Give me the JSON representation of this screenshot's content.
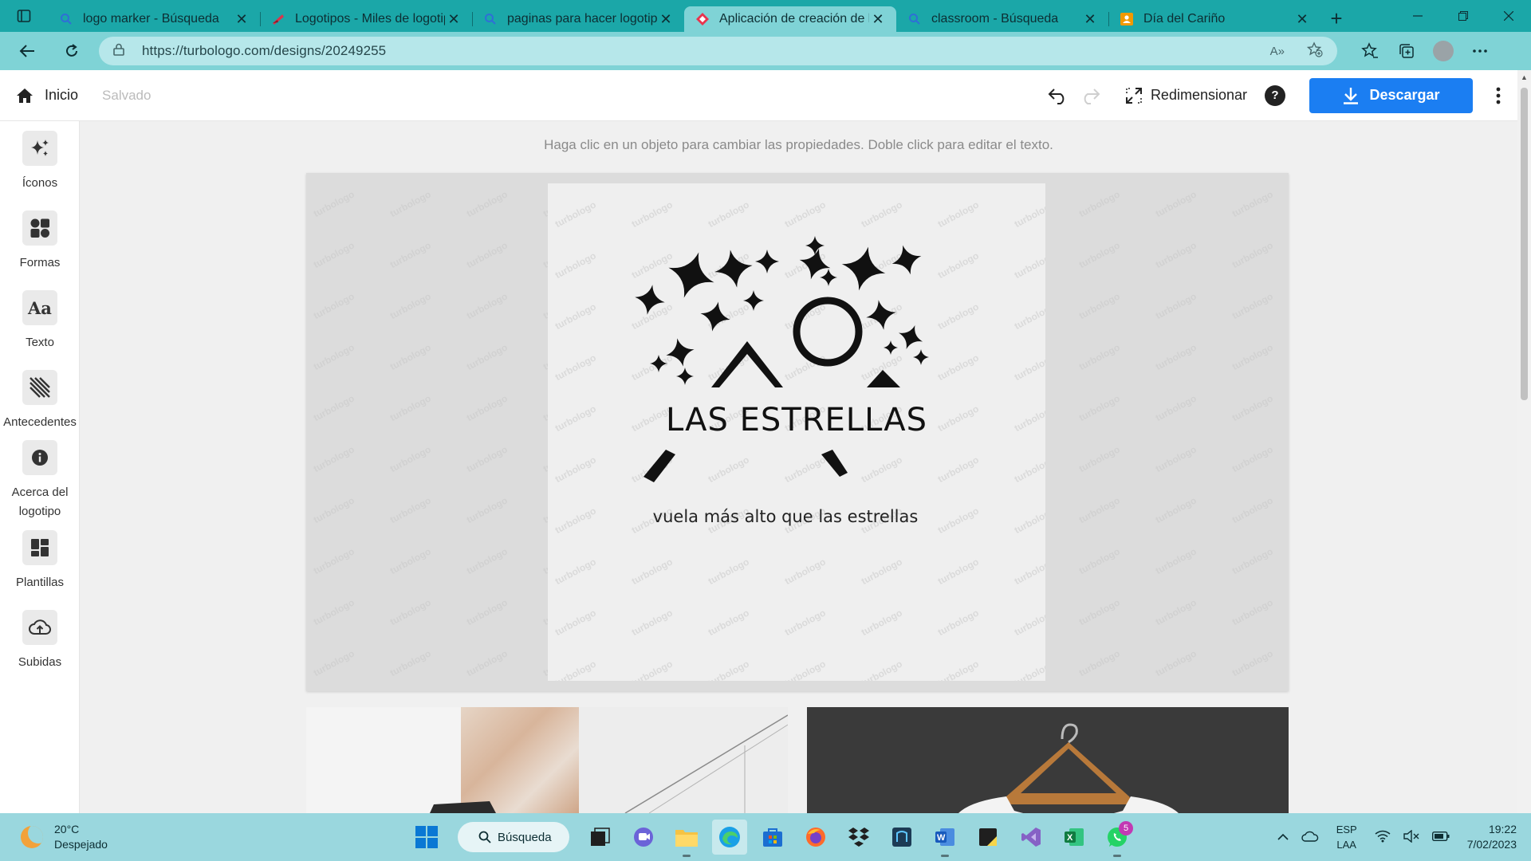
{
  "browser": {
    "tabs": [
      {
        "title": "logo marker - Búsqueda",
        "icon": "bing-search-icon",
        "active": false
      },
      {
        "title": "Logotipos - Miles de logotipos",
        "icon": "logotipos-site-icon",
        "active": false
      },
      {
        "title": "paginas para hacer logotipos",
        "icon": "bing-search-icon",
        "active": false
      },
      {
        "title": "Aplicación de creación de logotipos",
        "icon": "turbologo-icon",
        "active": true
      },
      {
        "title": "classroom - Búsqueda",
        "icon": "bing-search-icon",
        "active": false
      },
      {
        "title": "Día del Cariño",
        "icon": "classroom-icon",
        "active": false
      }
    ],
    "url": "https://turbologo.com/designs/20249255",
    "accent": "#1ba7a8"
  },
  "app": {
    "home_label": "Inicio",
    "saved_label": "Salvado",
    "resize_label": "Redimensionar",
    "help_label": "?",
    "download_label": "Descargar",
    "download_color": "#1b7ef2",
    "hint": "Haga clic en un objeto para cambiar las propiedades. Doble click para editar el texto."
  },
  "sidebar": {
    "items": [
      {
        "label": "Íconos",
        "icon": "sparkle-icon"
      },
      {
        "label": "Formas",
        "icon": "shapes-icon"
      },
      {
        "label": "Texto",
        "icon": "text-aa-icon"
      },
      {
        "label": "Antecedentes",
        "icon": "background-stripes-icon"
      },
      {
        "label": "Acerca del logotipo",
        "icon": "info-icon"
      },
      {
        "label": "Plantillas",
        "icon": "templates-grid-icon"
      },
      {
        "label": "Subidas",
        "icon": "cloud-upload-icon"
      }
    ]
  },
  "logo": {
    "name": "LAS ESTRELLAS",
    "slogan": "vuela más alto que las estrellas",
    "watermark": "turbologo"
  },
  "taskbar": {
    "weather_temp": "20°C",
    "weather_desc": "Despejado",
    "search_label": "Búsqueda",
    "whatsapp_badge": "5",
    "lang_top": "ESP",
    "lang_bottom": "LAA",
    "time": "19:22",
    "date": "7/02/2023"
  }
}
